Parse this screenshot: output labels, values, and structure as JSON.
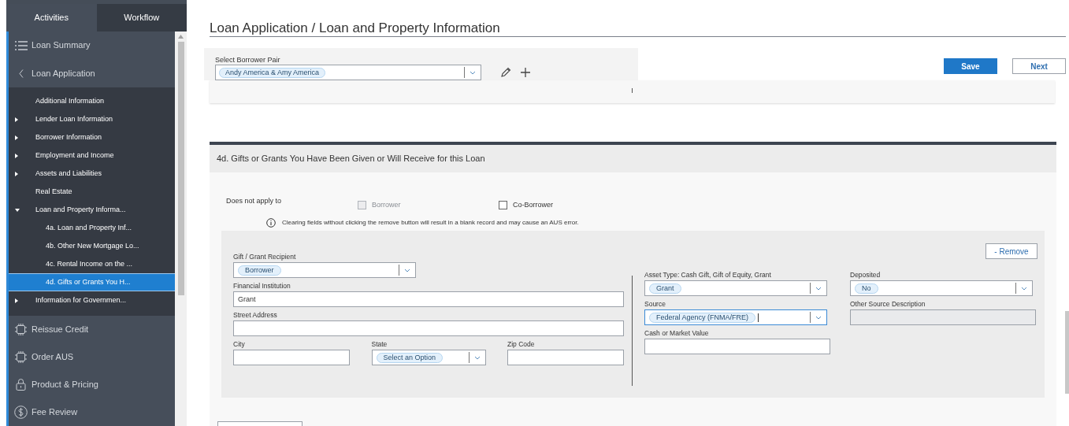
{
  "sidebar": {
    "tabs": [
      {
        "label": "Activities",
        "selected": false
      },
      {
        "label": "Workflow",
        "selected": true
      }
    ],
    "items": [
      {
        "label": "Loan Summary",
        "selected": false
      },
      {
        "label": "Loan Application",
        "selected": false,
        "children": [
          {
            "label": "Additional Information",
            "selected": false
          },
          {
            "label": "Lender Loan Information",
            "selected": false,
            "expanded": false
          },
          {
            "label": "Borrower Information",
            "selected": false,
            "expanded": false
          },
          {
            "label": "Employment and Income",
            "selected": false,
            "expanded": false
          },
          {
            "label": "Assets and Liabilities",
            "selected": false,
            "expanded": false
          },
          {
            "label": "Real Estate",
            "selected": false
          },
          {
            "label": "Loan and Property Informa...",
            "selected": false,
            "expanded": true,
            "children": [
              {
                "label": "4a. Loan and Property Inf...",
                "selected": false
              },
              {
                "label": "4b. Other New Mortgage Lo...",
                "selected": false
              },
              {
                "label": "4c. Rental Income on the ...",
                "selected": false
              },
              {
                "label": "4d. Gifts or Grants You H...",
                "selected": true
              }
            ]
          },
          {
            "label": "Information for Governmen...",
            "selected": false,
            "expanded": false
          }
        ]
      },
      {
        "label": "Reissue Credit",
        "selected": false
      },
      {
        "label": "Order AUS",
        "selected": false
      },
      {
        "label": "Product & Pricing",
        "selected": false
      },
      {
        "label": "Fee Review",
        "selected": false
      }
    ]
  },
  "page_title": "Loan Application / Loan and Property Information",
  "borrower_pair": {
    "label": "Select Borrower Pair",
    "value": "Andy America & Amy America"
  },
  "buttons": [
    {
      "label": "Save",
      "kind": "primary"
    },
    {
      "label": "Next",
      "kind": "secondary"
    }
  ],
  "section": {
    "title": "4d. Gifts or Grants You Have Been Given or Will Receive for this Loan",
    "does_not_apply": {
      "label": "Does not apply to",
      "options": [
        {
          "label": "Borrower",
          "checked": false,
          "disabled": true
        },
        {
          "label": "Co-Borrower",
          "checked": false,
          "disabled": false
        }
      ]
    },
    "notice": "Clearing fields without clicking the remove button will result in a blank record and may cause an AUS error.",
    "record": {
      "remove_button": "- Remove",
      "left_fields": [
        {
          "label": "Gift / Grant Recipient",
          "kind": "select",
          "value": "Borrower",
          "focused": false
        },
        {
          "label": "Financial Institution",
          "kind": "text",
          "value": "Grant",
          "focused": false
        },
        {
          "label": "Street Address",
          "kind": "text",
          "focused": false
        },
        {
          "label": "City",
          "kind": "text",
          "focused": false
        },
        {
          "label": "State",
          "kind": "select",
          "value": "Select an Option",
          "focused": false
        },
        {
          "label": "Zip Code",
          "kind": "text",
          "focused": false
        }
      ],
      "right_fields": [
        {
          "label": "Asset Type: Cash Gift, Gift of Equity, Grant",
          "kind": "select",
          "value": "Grant",
          "focused": false
        },
        {
          "label": "Deposited",
          "kind": "select",
          "value": "No",
          "focused": false
        },
        {
          "label": "Source",
          "kind": "select",
          "value": "Federal Agency (FNMA/FRE)",
          "focused": true
        },
        {
          "label": "Other Source Description",
          "kind": "disabled",
          "focused": false
        },
        {
          "label": "Cash or Market Value",
          "kind": "text",
          "focused": false
        }
      ]
    }
  }
}
